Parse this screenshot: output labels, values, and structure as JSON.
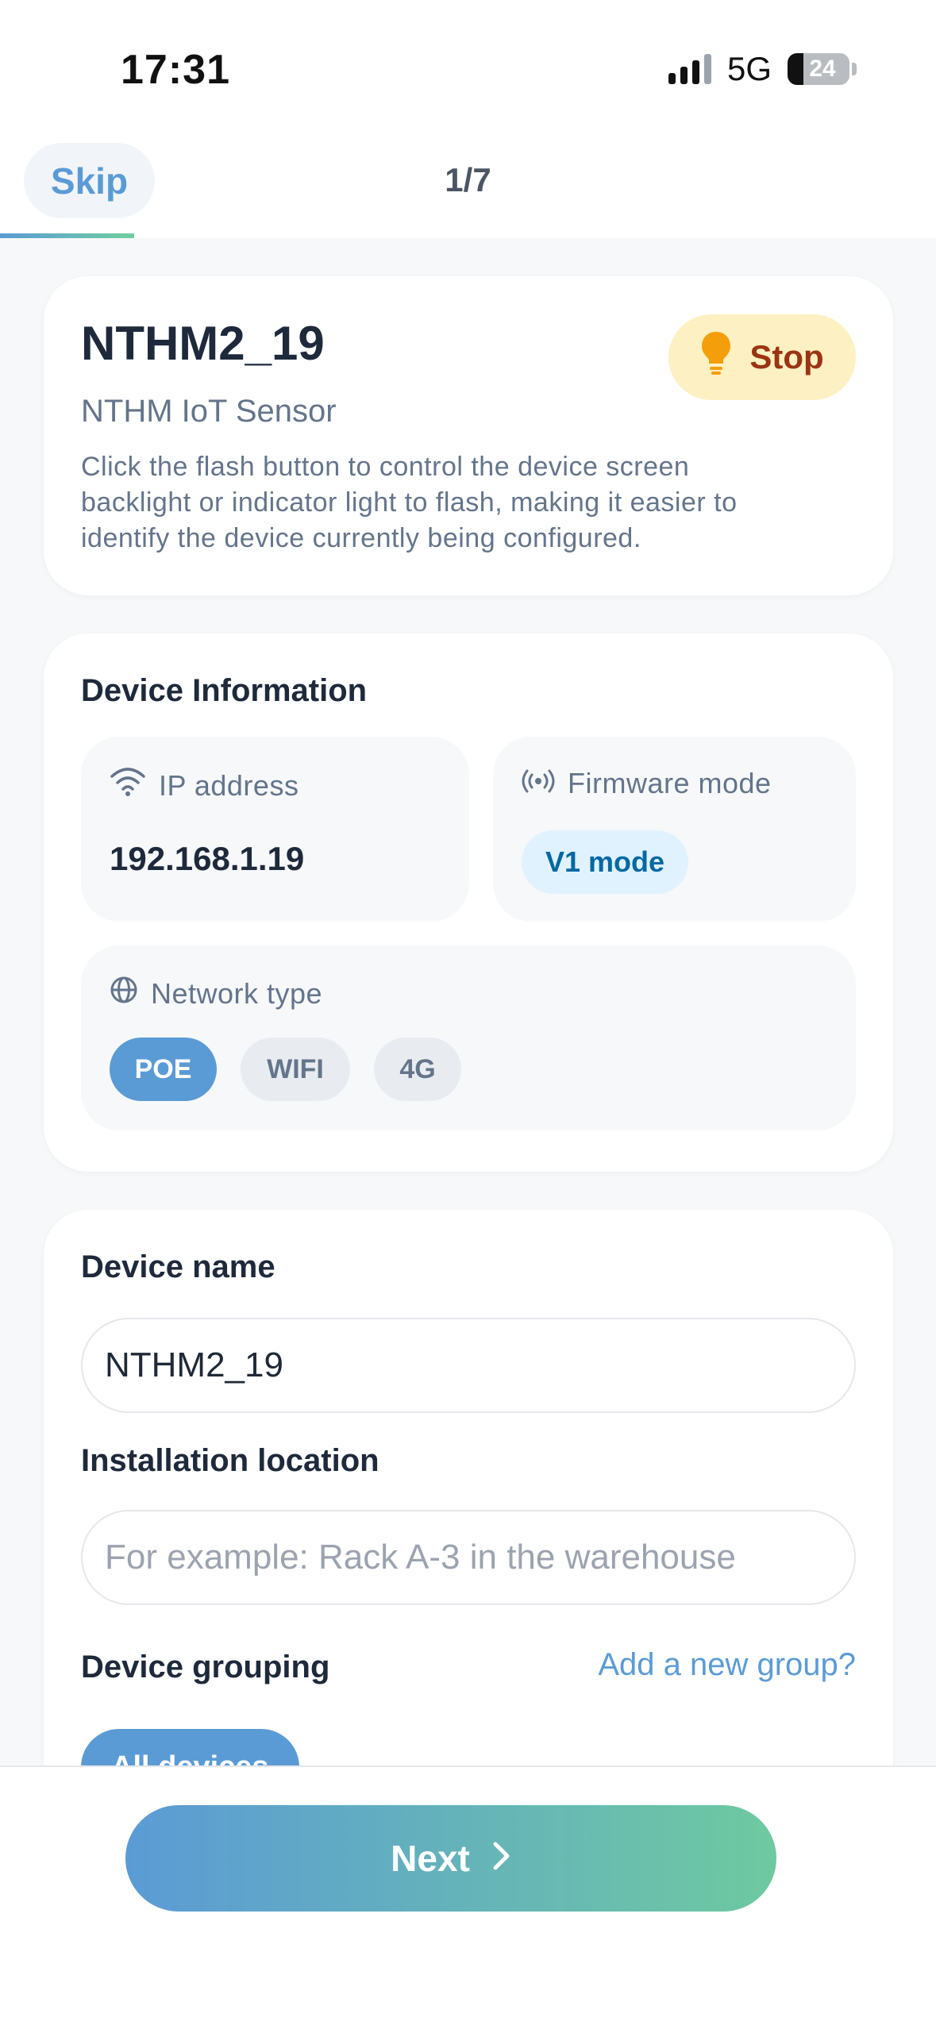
{
  "status_bar": {
    "time": "17:31",
    "network": "5G",
    "battery": "24"
  },
  "header": {
    "skip_label": "Skip",
    "step": "1/7",
    "progress_fraction": 0.143
  },
  "device_card": {
    "title": "NTHM2_19",
    "subtitle": "NTHM IoT Sensor",
    "description": "Click the flash button to control the device screen backlight or indicator light to flash, making it easier to identify the device currently being configured.",
    "flash_button_label": "Stop",
    "flash_icon": "lightbulb-icon"
  },
  "device_info": {
    "title": "Device Information",
    "ip_label": "IP address",
    "ip_icon": "wifi-icon",
    "ip_value": "192.168.1.19",
    "firmware_label": "Firmware mode",
    "firmware_icon": "broadcast-icon",
    "firmware_value": "V1 mode",
    "network_label": "Network type",
    "network_icon": "globe-icon",
    "network_options": [
      "POE",
      "WIFI",
      "4G"
    ],
    "network_selected": "POE"
  },
  "form": {
    "device_name_label": "Device name",
    "device_name_value": "NTHM2_19",
    "location_label": "Installation location",
    "location_placeholder": "For example: Rack A-3 in the warehouse",
    "grouping_label": "Device grouping",
    "add_group_link": "Add a new group?",
    "groups": [
      "All devices"
    ]
  },
  "footer": {
    "next_label": "Next",
    "next_icon": "chevron-right-icon"
  },
  "colors": {
    "accent_blue": "#5b9bd5",
    "accent_green": "#6fcf9e",
    "stop_bg": "#fdf0c2",
    "stop_text": "#9a3412",
    "bulb": "#f59e0b"
  }
}
